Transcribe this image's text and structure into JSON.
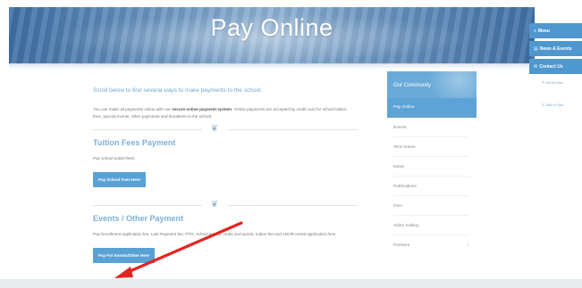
{
  "hero": {
    "title": "Pay Online"
  },
  "right_nav": {
    "buttons": [
      {
        "icon": "≡",
        "label": "Menu"
      },
      {
        "icon": "▤",
        "label": "News & Events"
      },
      {
        "icon": "✉",
        "label": "Contact Us"
      }
    ],
    "links": [
      {
        "icon": "✎",
        "label": "Enroll Now"
      },
      {
        "icon": "⚲",
        "label": "Take a Tour"
      }
    ]
  },
  "main": {
    "intro": "Scroll below to find several ways to make payments to the school.",
    "para_before": "You can make all payments online with our ",
    "para_bold": "secure online payment system",
    "para_after": ". Online payments are accepted by credit card for school tuition fees, special events, other payments and donations to the school.",
    "tuition": {
      "title": "Tuition Fees Payment",
      "text": "Pay school tuition fees.",
      "button": "Pay School Fees Here"
    },
    "events": {
      "title": "Events / Other Payment",
      "text": "Pay Enrollment Application fee, Late Payment fee, PTO, school events, clubs and sports, tuition fee and ADOR rental application fees.",
      "button": "Pay For Events/Other Here"
    }
  },
  "sidebar": {
    "header": "Our Community",
    "active": "Pay Online",
    "items": [
      {
        "label": "Events"
      },
      {
        "label": "Term Dates"
      },
      {
        "label": "News"
      },
      {
        "label": "Publications"
      },
      {
        "label": "Give"
      },
      {
        "label": "Video Gallery"
      },
      {
        "label": "Partners",
        "plus": "+"
      }
    ]
  },
  "colors": {
    "accent": "#59a2d6",
    "sidebar_header": "#6aaad9",
    "annotation_arrow": "#e52421"
  }
}
